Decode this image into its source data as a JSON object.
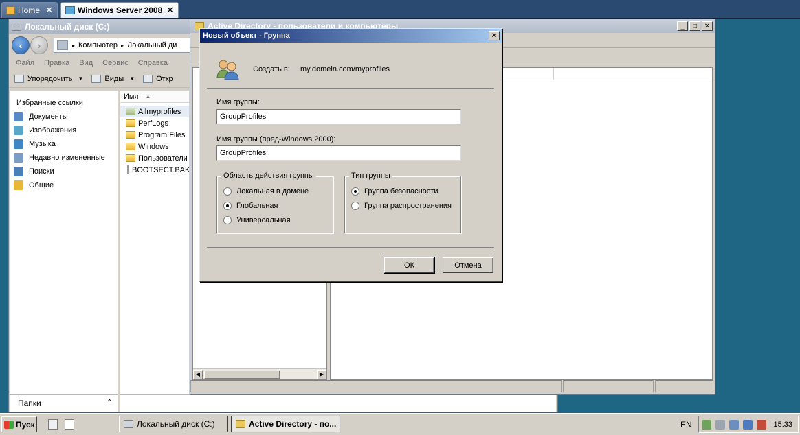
{
  "host_tabs": [
    {
      "label": "Home"
    },
    {
      "label": "Windows Server 2008"
    }
  ],
  "explorer": {
    "title": "Локальный диск (C:)",
    "breadcrumb": [
      "Компьютер",
      "Локальный ди"
    ],
    "menu": [
      "Файл",
      "Правка",
      "Вид",
      "Сервис",
      "Справка"
    ],
    "toolbar": {
      "organize": "Упорядочить",
      "views": "Виды",
      "open": "Откр"
    },
    "favorites_title": "Избранные ссылки",
    "nav_items": [
      {
        "label": "Документы",
        "color": "#5a8ac6"
      },
      {
        "label": "Изображения",
        "color": "#58a6c9"
      },
      {
        "label": "Музыка",
        "color": "#3f86c4"
      },
      {
        "label": "Недавно измененные",
        "color": "#7b9cc4"
      },
      {
        "label": "Поиски",
        "color": "#4a7fb8"
      },
      {
        "label": "Общие",
        "color": "#e8b73a"
      }
    ],
    "list_header": "Имя",
    "files": [
      {
        "name": "Allmyprofiles",
        "kind": "special"
      },
      {
        "name": "PerfLogs",
        "kind": "folder"
      },
      {
        "name": "Program Files",
        "kind": "folder"
      },
      {
        "name": "Windows",
        "kind": "folder"
      },
      {
        "name": "Пользователи",
        "kind": "folder"
      },
      {
        "name": "BOOTSECT.BAK",
        "kind": "file"
      }
    ],
    "folders_pane": "Папки"
  },
  "ad_window": {
    "title": "Active Directory - пользователи и компьютеры"
  },
  "dialog": {
    "title": "Новый объект - Группа",
    "created_in_label": "Создать в:",
    "created_in_path": "my.domein.com/myprofiles",
    "group_name_label": "Имя группы:",
    "group_name_value": "GroupProfiles",
    "group_name_pre2000_label": "Имя группы (пред-Windows 2000):",
    "group_name_pre2000_value": "GroupProfiles",
    "scope": {
      "legend": "Область действия группы",
      "options": [
        {
          "label": "Локальная в домене",
          "selected": false
        },
        {
          "label": "Глобальная",
          "selected": true
        },
        {
          "label": "Универсальная",
          "selected": false
        }
      ]
    },
    "type": {
      "legend": "Тип группы",
      "options": [
        {
          "label": "Группа безопасности",
          "selected": true
        },
        {
          "label": "Группа распространения",
          "selected": false
        }
      ]
    },
    "ok_label": "ОК",
    "cancel_label": "Отмена"
  },
  "taskbar": {
    "start_label": "Пуск",
    "tasks": [
      {
        "label": "Локальный диск (C:)"
      },
      {
        "label": "Active Directory - по..."
      }
    ],
    "language": "EN",
    "clock": "15:33"
  }
}
